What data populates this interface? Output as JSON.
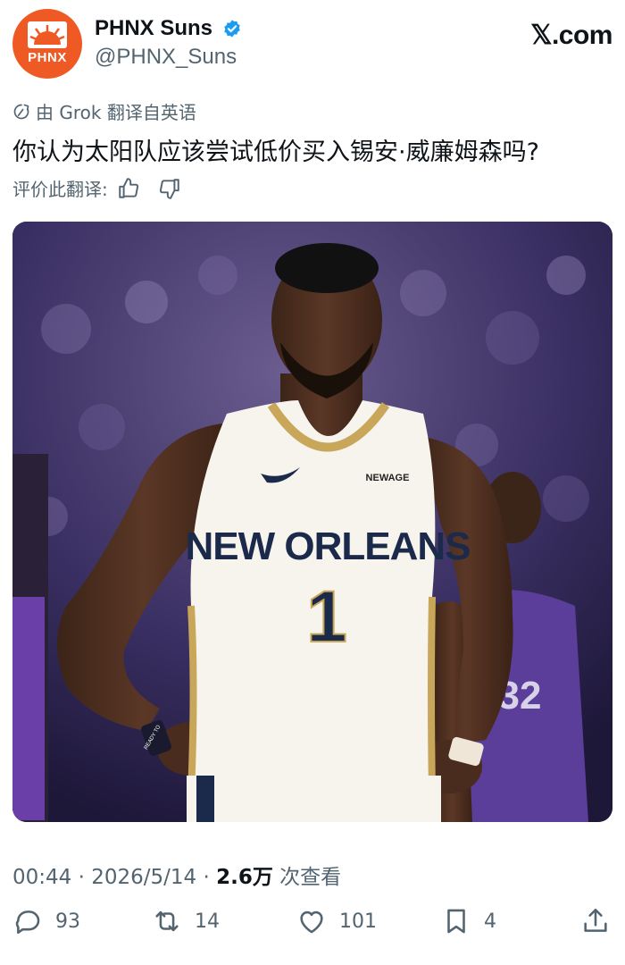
{
  "account": {
    "display_name": "PHNX Suns",
    "handle": "@PHNX_Suns",
    "avatar_text": "PHNX",
    "avatar_color": "#ef5a24",
    "verified_color": "#1d9bf0"
  },
  "site_logo": "𝕏.com",
  "translation": {
    "label": "由 Grok 翻译自英语",
    "icon": "translate-icon"
  },
  "tweet": {
    "text": "你认为太阳队应该尝试低价买入锡安·威廉姆森吗?"
  },
  "rate": {
    "label": "评价此翻译:",
    "up_icon": "thumbs-up-icon",
    "down_icon": "thumbs-down-icon"
  },
  "photo": {
    "jersey_text": "NEW ORLEANS",
    "jersey_number": "1",
    "sponsor_text": "NEWAGE",
    "wristband_text": "READY TO",
    "opponent_jersey_number": "32"
  },
  "meta": {
    "time": "00:44",
    "separator": " · ",
    "date": "2026/5/14",
    "views": "2.6万",
    "views_label": " 次查看"
  },
  "actions": {
    "replies": "93",
    "retweets": "14",
    "likes": "101",
    "bookmarks": "4"
  }
}
